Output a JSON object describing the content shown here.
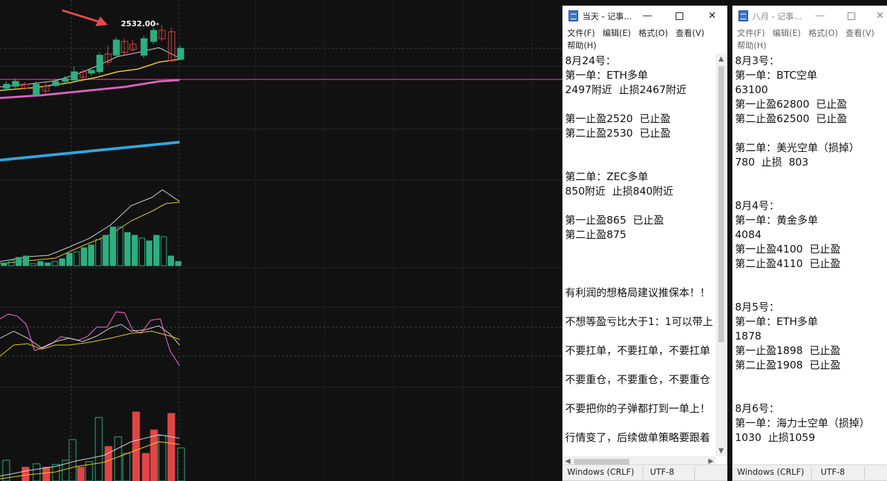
{
  "chart": {
    "price_label": "2532.00",
    "colors": {
      "background": "#111112",
      "up": "#2fae80",
      "down": "#e04545",
      "ma_white": "#d8d8d8",
      "ma_yellow": "#f0d020",
      "ma_pink": "#e060c0",
      "ma_blue": "#2ea8e0",
      "price_line": "#c02a8a",
      "arrow": "#e84a4a"
    }
  },
  "notepad1": {
    "title": "当天 - 记事...",
    "menu": [
      "文件(F)",
      "编辑(E)",
      "格式(O)",
      "查看(V)",
      "帮助(H)"
    ],
    "lines": [
      "8月24号：",
      "第一单：ETH多单",
      "2497附近  止损2467附近",
      "",
      "第一止盈2520  已止盈",
      "第二止盈2530  已止盈",
      "",
      "",
      "第二单：ZEC多单",
      "850附近  止损840附近",
      "",
      "第一止盈865  已止盈",
      "第二止盈875",
      "",
      "",
      "",
      "有利润的想格局建议推保本！！",
      "",
      "不想等盈亏比大于1：1可以带上",
      "",
      "不要扛单，不要扛单，不要扛单",
      "",
      "不要重仓，不要重仓，不要重仓",
      "",
      "不要把你的子弹都打到一单上！",
      "",
      "行情变了，后续做单策略要跟着"
    ],
    "status_eol": "Windows (CRLF)",
    "status_encoding": "UTF-8"
  },
  "notepad2": {
    "title": "八月 - 记事...",
    "menu": [
      "文件(F)",
      "编辑(E)",
      "格式(O)",
      "查看(V)",
      "帮助(H)"
    ],
    "lines": [
      "8月3号：",
      "第一单：BTC空单",
      "63100",
      "第一止盈62800  已止盈",
      "第二止盈62500  已止盈",
      "",
      "第二单：美光空单（损掉）",
      "780  止损  803",
      "",
      "",
      "8月4号：",
      "第一单：黄金多单",
      "4084",
      "第一止盈4100  已止盈",
      "第二止盈4110  已止盈",
      "",
      "",
      "8月5号：",
      "第一单：ETH多单",
      "1878",
      "第一止盈1898  已止盈",
      "第二止盈1908  已止盈",
      "",
      "",
      "8月6号：",
      "第一单：海力士空单（损掉）",
      "1030  止损1059"
    ],
    "status_eol": "Windows (CRLF)",
    "status_encoding": "UTF-8"
  }
}
